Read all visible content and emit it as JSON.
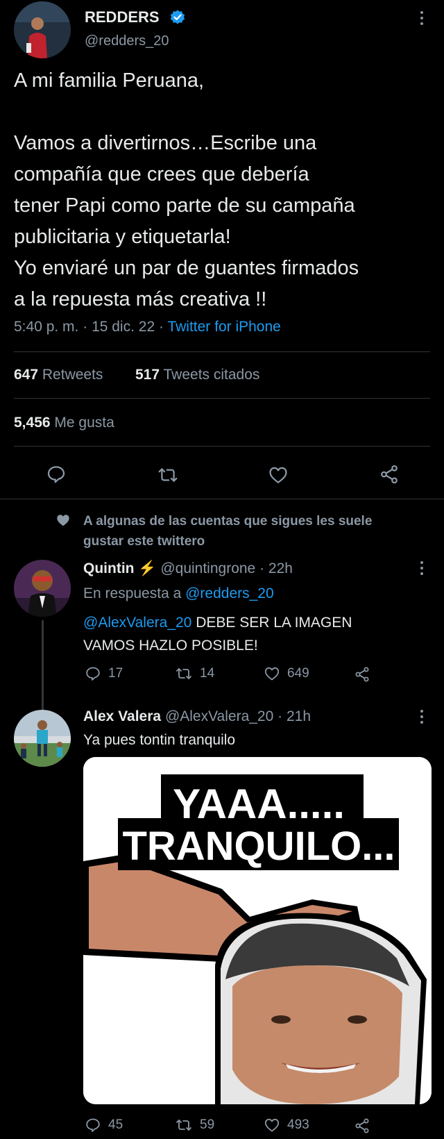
{
  "main_tweet": {
    "author_name": "REDDERS",
    "author_handle": "@redders_20",
    "text_line1": "A mi familia Peruana,",
    "text_body": [
      "Vamos a divertirnos…Escribe una",
      "compañía que crees que debería",
      "tener Papi como parte de su campaña",
      "publicitaria y etiquetarla!",
      "Yo enviaré un par de guantes firmados",
      "a la repuesta más creativa !!"
    ],
    "time": "5:40 p. m.",
    "date": "15 dic. 22",
    "source": "Twitter for iPhone",
    "retweets_count": "647",
    "retweets_label": "Retweets",
    "quotes_count": "517",
    "quotes_label": "Tweets citados",
    "likes_count": "5,456",
    "likes_label": "Me gusta"
  },
  "social_context": {
    "text_line1": "A algunas de las cuentas que sigues les suele",
    "text_line2": "gustar este twittero"
  },
  "reply1": {
    "author_name": "Quintin",
    "emoji": "⚡",
    "handle": "@quintingrone",
    "time": "22h",
    "replying_prefix": "En respuesta a",
    "replying_to": "@redders_20",
    "mention": "@AlexValera_20",
    "text_inline": " DEBE SER LA IMAGEN",
    "text_line2": "VAMOS HAZLO POSIBLE!",
    "replies": "17",
    "retweets": "14",
    "likes": "649"
  },
  "reply2": {
    "author_name": "Alex Valera",
    "handle": "@AlexValera_20",
    "time": "21h",
    "text": "Ya pues tontin tranquilo",
    "image_caption_line1": "YAAA.....",
    "image_caption_line2": "TRANQUILO...",
    "replies": "45",
    "retweets": "59",
    "likes": "493"
  },
  "colors": {
    "background": "#000000",
    "accent": "#1d9bf0",
    "muted": "#8b98a5",
    "divider": "#2f3336"
  }
}
